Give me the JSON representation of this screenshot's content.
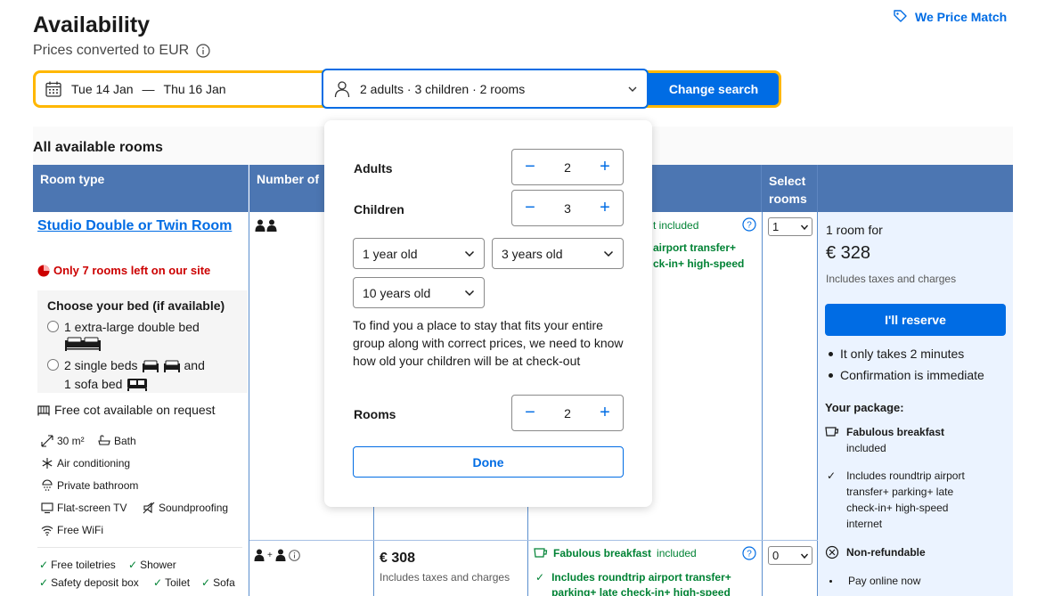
{
  "header": {
    "title": "Availability",
    "subtitle": "Prices converted to EUR",
    "price_match": "We Price Match"
  },
  "search": {
    "check_in": "Tue 14 Jan",
    "dash": "—",
    "check_out": "Thu 16 Jan",
    "occupancy": "2 adults · 3 children · 2 rooms",
    "change_search": "Change search"
  },
  "section_title": "All available rooms",
  "table_header": {
    "room_type": "Room type",
    "number_of": "Number of",
    "select_rooms": "Select rooms"
  },
  "room": {
    "name": "Studio Double or Twin Room",
    "rooms_left": "Only 7 rooms left on our site",
    "choose_bed_title": "Choose your bed (if available)",
    "bed_option_1": "1 extra-large double bed",
    "bed_option_2_a": "2 single beds",
    "bed_option_2_b": "and",
    "bed_option_2_c": "1 sofa bed",
    "free_cot": "Free cot available on request",
    "facilities": {
      "size": "30 m²",
      "bath": "Bath",
      "air_conditioning": "Air conditioning",
      "private_bathroom": "Private bathroom",
      "tv": "Flat-screen TV",
      "soundproofing": "Soundproofing",
      "wifi": "Free WiFi"
    },
    "amenities": [
      "Free toiletries",
      "Shower",
      "Safety deposit box",
      "Toilet",
      "Sofa"
    ]
  },
  "row1": {
    "breakfast_tail": "t included",
    "transfer_line1": "airport transfer+",
    "transfer_line2": "ck-in+ high-speed",
    "select_value": "1"
  },
  "row2": {
    "plus": "+",
    "price": "€ 308",
    "includes": "Includes taxes and charges",
    "breakfast_bold": "Fabulous breakfast",
    "breakfast_rest": "included",
    "transfer_line1": "Includes roundtrip airport transfer+",
    "transfer_line2": "parking+ late check-in+ high-speed",
    "select_value": "0"
  },
  "summary": {
    "one_room_for": "1 room for",
    "price": "€ 328",
    "includes": "Includes taxes and charges",
    "reserve": "I'll reserve",
    "bullet_1": "It only takes 2 minutes",
    "bullet_2": "Confirmation is immediate",
    "package_title": "Your package:",
    "pkg_breakfast_bold": "Fabulous breakfast",
    "pkg_breakfast_rest": "included",
    "pkg_transfer_1": "Includes roundtrip airport",
    "pkg_transfer_2": "transfer+ parking+ late",
    "pkg_transfer_3": "check-in+ high-speed",
    "pkg_transfer_4": "internet",
    "non_refundable": "Non-refundable",
    "pay_online": "Pay online now"
  },
  "popup": {
    "adults_label": "Adults",
    "adults_value": "2",
    "children_label": "Children",
    "children_value": "3",
    "child_age_1": "1 year old",
    "child_age_2": "3 years old",
    "child_age_3": "10 years old",
    "note": "To find you a place to stay that fits your entire group along with correct prices, we need to know how old your children will be at check-out",
    "rooms_label": "Rooms",
    "rooms_value": "2",
    "minus": "−",
    "plus": "+",
    "done": "Done"
  },
  "colors": {
    "primary": "#006ce4",
    "header_blue": "#4c76b2",
    "search_yellow": "#ffb700",
    "success_green": "#008234",
    "urgent_red": "#cc0000"
  }
}
